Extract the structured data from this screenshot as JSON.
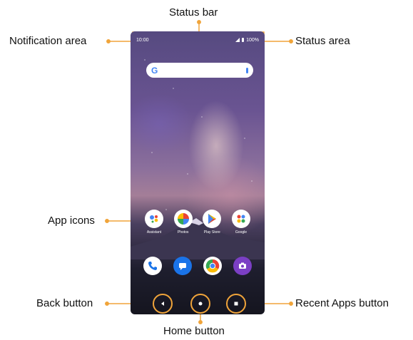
{
  "labels": {
    "status_bar": "Status bar",
    "notification_area": "Notification area",
    "status_area": "Status area",
    "app_icons": "App icons",
    "back_button": "Back button",
    "home_button": "Home button",
    "recent_apps_button": "Recent Apps button"
  },
  "phone": {
    "time": "10:00",
    "battery": "100%",
    "search_logo": "G",
    "apps": [
      {
        "label": "Assistant",
        "icon": "assistant-icon"
      },
      {
        "label": "Photos",
        "icon": "photos-icon"
      },
      {
        "label": "Play Store",
        "icon": "play-store-icon"
      },
      {
        "label": "Google",
        "icon": "google-folder-icon"
      }
    ],
    "dock": [
      {
        "icon": "phone-icon",
        "color": "#1a73e8"
      },
      {
        "icon": "messages-icon",
        "color": "#1a73e8"
      },
      {
        "icon": "chrome-icon",
        "color": "#ffffff"
      },
      {
        "icon": "camera-icon",
        "color": "#7b3fc4"
      }
    ]
  },
  "colors": {
    "callout": "#f0a43a",
    "nav_button_border": "#f0a43a"
  }
}
